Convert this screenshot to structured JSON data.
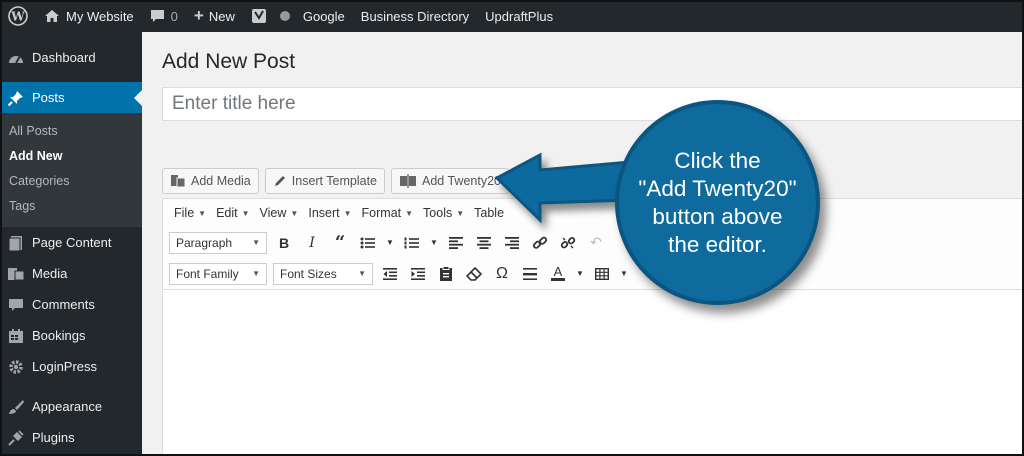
{
  "adminbar": {
    "site_name": "My Website",
    "comments_count": "0",
    "new_label": "New",
    "links": [
      "Google",
      "Business Directory",
      "UpdraftPlus"
    ]
  },
  "sidebar": {
    "items": [
      {
        "label": "Dashboard",
        "icon": "dashboard-icon"
      },
      {
        "label": "Posts",
        "icon": "pin-icon"
      },
      {
        "label": "Page Content",
        "icon": "page-icon"
      },
      {
        "label": "Media",
        "icon": "media-icon"
      },
      {
        "label": "Comments",
        "icon": "comment-icon"
      },
      {
        "label": "Bookings",
        "icon": "calendar-icon"
      },
      {
        "label": "LoginPress",
        "icon": "gear-icon"
      },
      {
        "label": "Appearance",
        "icon": "brush-icon"
      },
      {
        "label": "Plugins",
        "icon": "plug-icon"
      }
    ],
    "submenu": [
      "All Posts",
      "Add New",
      "Categories",
      "Tags"
    ]
  },
  "page": {
    "title": "Add New Post",
    "title_placeholder": "Enter title here"
  },
  "media_buttons": [
    "Add Media",
    "Insert Template",
    "Add Twenty20"
  ],
  "editor": {
    "menus": [
      "File",
      "Edit",
      "View",
      "Insert",
      "Format",
      "Tools",
      "Table"
    ],
    "format_select": "Paragraph",
    "font_family": "Font Family",
    "font_sizes": "Font Sizes"
  },
  "callout": {
    "lines": [
      "Click the",
      "\"Add Twenty20\"",
      "button above",
      "the editor."
    ],
    "color": "#0f6a9e"
  },
  "colors": {
    "admin_bg": "#23282d",
    "accent": "#0073aa"
  }
}
